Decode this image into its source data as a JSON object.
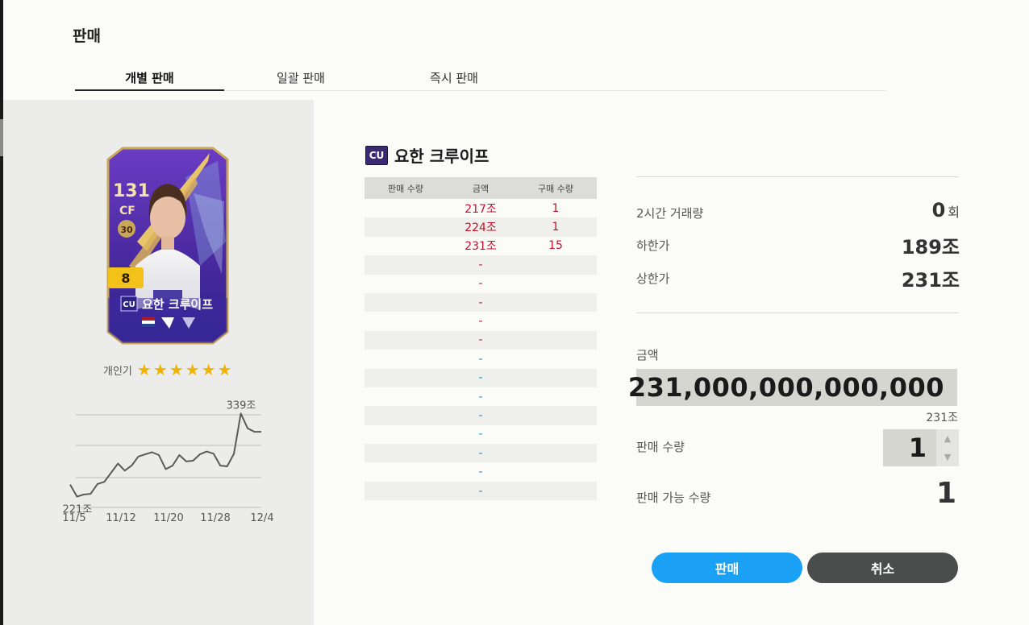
{
  "dialog": {
    "title": "판매"
  },
  "tabs": [
    {
      "label": "개별 판매",
      "active": true
    },
    {
      "label": "일괄 판매",
      "active": false
    },
    {
      "label": "즉시 판매",
      "active": false
    }
  ],
  "card": {
    "ovr": "131",
    "position": "CF",
    "season_badge": "30",
    "enhance_level": "8",
    "season_tag": "CU",
    "name": "요한 크루이프"
  },
  "popularity": {
    "label": "개인기",
    "stars": 6,
    "star_glyph": "★"
  },
  "chart_data": {
    "type": "line",
    "x_ticks": [
      "11/5",
      "11/12",
      "11/20",
      "11/28",
      "12/4"
    ],
    "values": [
      238,
      221,
      224,
      225,
      239,
      242,
      255,
      268,
      258,
      265,
      278,
      281,
      284,
      280,
      260,
      265,
      280,
      271,
      272,
      281,
      285,
      282,
      265,
      264,
      282,
      339,
      318,
      313,
      313
    ],
    "min_label": "221조",
    "max_label": "339조",
    "ylim": [
      200,
      360
    ],
    "grid": true
  },
  "player": {
    "season_tag": "CU",
    "name": "요한 크루이프"
  },
  "order_table": {
    "headers": [
      "판매 수량",
      "금액",
      "구매 수량"
    ],
    "rows": [
      {
        "sell_qty": "",
        "price": "217조",
        "buy_qty": "1",
        "color": "red"
      },
      {
        "sell_qty": "",
        "price": "224조",
        "buy_qty": "1",
        "color": "red"
      },
      {
        "sell_qty": "",
        "price": "231조",
        "buy_qty": "15",
        "color": "red"
      },
      {
        "sell_qty": "",
        "price": "-",
        "buy_qty": "",
        "color": "red"
      },
      {
        "sell_qty": "",
        "price": "-",
        "buy_qty": "",
        "color": "red"
      },
      {
        "sell_qty": "",
        "price": "-",
        "buy_qty": "",
        "color": "red"
      },
      {
        "sell_qty": "",
        "price": "-",
        "buy_qty": "",
        "color": "red"
      },
      {
        "sell_qty": "",
        "price": "-",
        "buy_qty": "",
        "color": "red"
      },
      {
        "sell_qty": "",
        "price": "-",
        "buy_qty": "",
        "color": "blue"
      },
      {
        "sell_qty": "",
        "price": "-",
        "buy_qty": "",
        "color": "blue"
      },
      {
        "sell_qty": "",
        "price": "-",
        "buy_qty": "",
        "color": "blue"
      },
      {
        "sell_qty": "",
        "price": "-",
        "buy_qty": "",
        "color": "blue"
      },
      {
        "sell_qty": "",
        "price": "-",
        "buy_qty": "",
        "color": "blue"
      },
      {
        "sell_qty": "",
        "price": "-",
        "buy_qty": "",
        "color": "blue"
      },
      {
        "sell_qty": "",
        "price": "-",
        "buy_qty": "",
        "color": "blue"
      },
      {
        "sell_qty": "",
        "price": "-",
        "buy_qty": "",
        "color": "blue"
      }
    ]
  },
  "stats": {
    "volume_label": "2시간 거래량",
    "volume_value": "0",
    "volume_unit": "회",
    "floor_label": "하한가",
    "floor_value": "189조",
    "ceiling_label": "상한가",
    "ceiling_value": "231조"
  },
  "sell_form": {
    "amount_label": "금액",
    "amount_value": "231,000,000,000,000",
    "amount_short": "231조",
    "qty_label": "판매 수량",
    "qty_value": "1",
    "available_label": "판매 가능 수량",
    "available_value": "1"
  },
  "buttons": {
    "sell": "판매",
    "cancel": "취소"
  },
  "colors": {
    "sell_button": "#1aa0f5",
    "cancel_button": "#4b4d4c",
    "price_high": "#c8102e",
    "price_low": "#1f8fd6",
    "star": "#f0b400"
  }
}
